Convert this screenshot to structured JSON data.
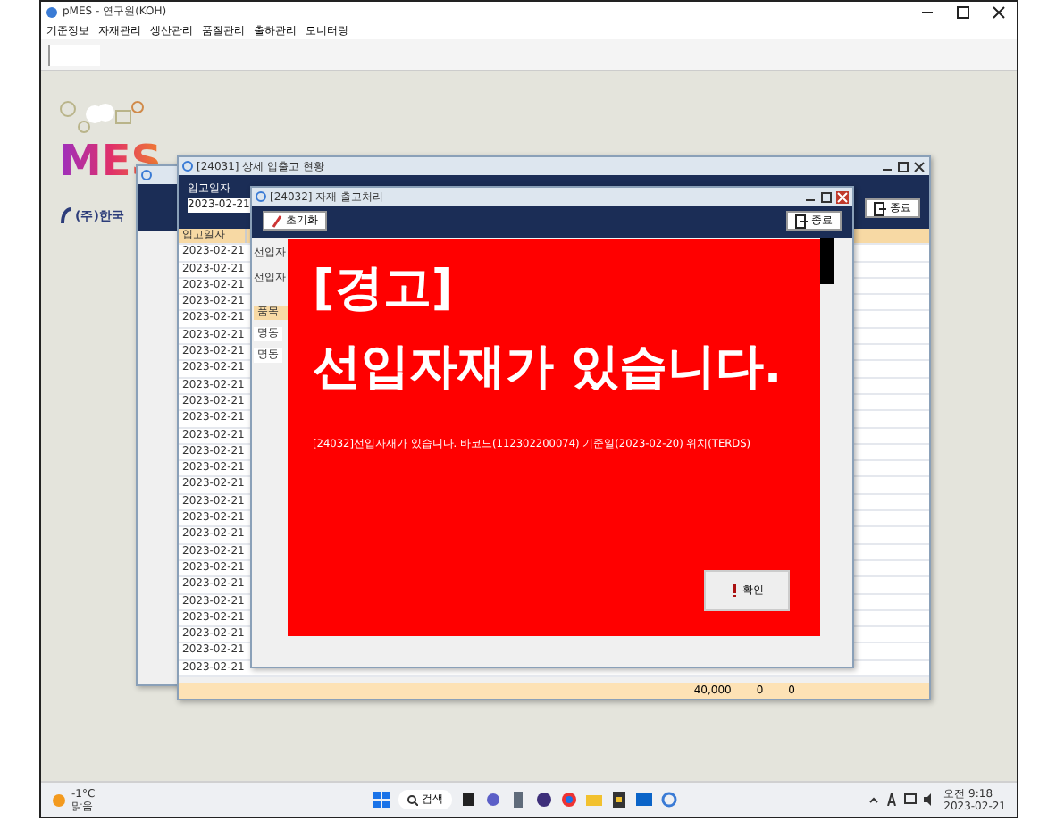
{
  "app_window": {
    "title": "pMES - 연구원(KOH)",
    "menu": [
      "기준정보",
      "자재관리",
      "생산관리",
      "품질관리",
      "출하관리",
      "모니터링"
    ]
  },
  "logo": {
    "text": "MES",
    "company": "(주)한국"
  },
  "status_window": {
    "title": "[24031] 상세 입출고 현황",
    "filter_label": "입고일자",
    "filter_value": "2023-02-21",
    "close_button": "종료",
    "columns": [
      "입고일자"
    ],
    "rows": [
      "2023-02-21",
      "2023-02-21",
      "2023-02-21",
      "2023-02-21",
      "2023-02-21",
      "2023-02-21",
      "2023-02-21",
      "2023-02-21",
      "2023-02-21",
      "2023-02-21",
      "2023-02-21",
      "2023-02-21",
      "2023-02-21",
      "2023-02-21",
      "2023-02-21",
      "2023-02-21",
      "2023-02-21",
      "2023-02-21",
      "2023-02-21",
      "2023-02-21",
      "2023-02-21",
      "2023-02-21",
      "2023-02-21",
      "2023-02-21",
      "2023-02-21",
      "2023-02-21"
    ],
    "totals": [
      "40,000",
      "0",
      "0"
    ]
  },
  "issue_window": {
    "title": "[24032] 자재 출고처리",
    "reset_button": "초기화",
    "close_button": "종료",
    "labels": [
      "선입자",
      "선입자"
    ],
    "grid_header": "품목",
    "rows": [
      "명동",
      "명동"
    ]
  },
  "alert": {
    "heading": "[경고]",
    "message": "선입자재가 있습니다.",
    "detail": "[24032]선입자재가 있습니다. 바코드(112302200074) 기준일(2023-02-20) 위치(TERDS)",
    "ok_button": "확인"
  },
  "taskbar": {
    "weather_temp": "-1°C",
    "weather_text": "맑음",
    "search": "검색",
    "time": "오전 9:18",
    "date": "2023-02-21"
  }
}
